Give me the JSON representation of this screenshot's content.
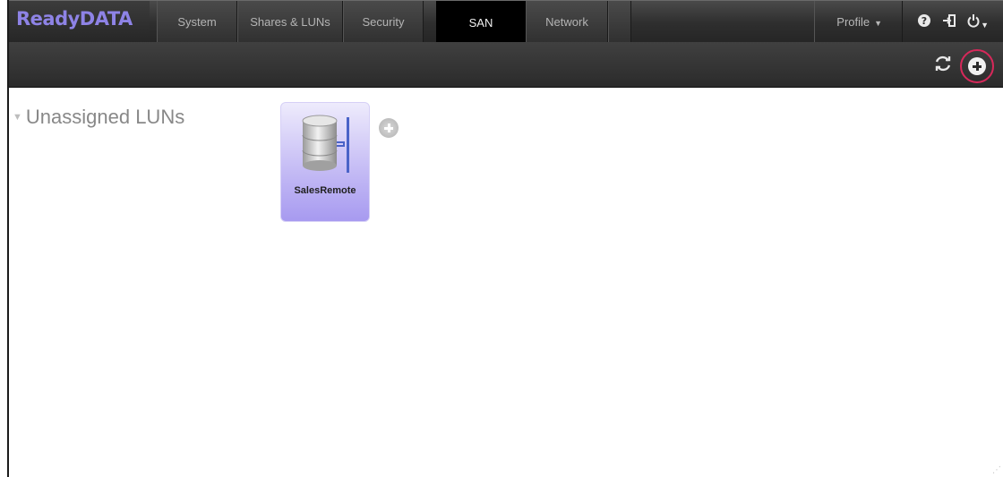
{
  "brand": "ReadyDATA",
  "nav": {
    "tabs": [
      {
        "label": "System"
      },
      {
        "label": "Shares & LUNs"
      },
      {
        "label": "Security"
      },
      {
        "label": "SAN",
        "active": true
      },
      {
        "label": "Network"
      }
    ],
    "profile_label": "Profile",
    "icons": [
      "help-icon",
      "logout-icon",
      "power-icon"
    ]
  },
  "toolbar": {
    "icons": [
      "refresh-icon",
      "add-lun-group-icon"
    ],
    "highlight_color": "#d7285a"
  },
  "content": {
    "group_title": "Unassigned LUNs",
    "luns": [
      {
        "name": "SalesRemote"
      }
    ]
  },
  "colors": {
    "brand": "#8e83e6",
    "tile_gradient_top": "#eeebfc",
    "tile_gradient_bottom": "#a79af0"
  }
}
